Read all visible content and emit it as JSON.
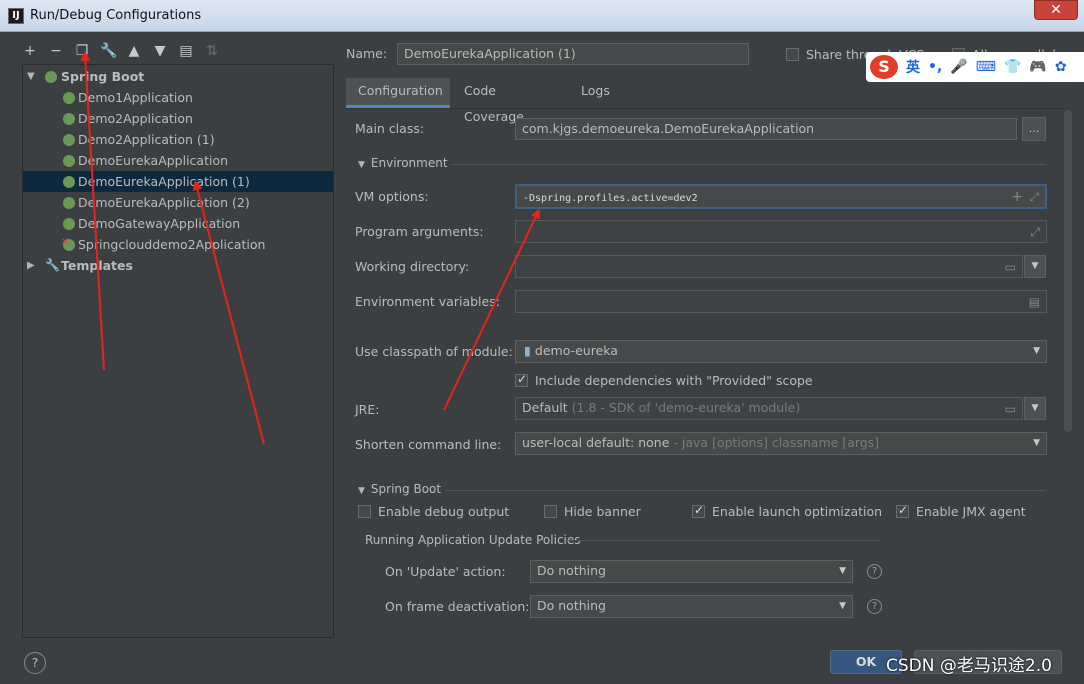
{
  "window": {
    "title": "Run/Debug Configurations",
    "app_icon_letter": "IJ",
    "close_glyph": "✕"
  },
  "toolbar": [
    {
      "name": "add-icon",
      "glyph": "+"
    },
    {
      "name": "remove-icon",
      "glyph": "−"
    },
    {
      "name": "copy-icon",
      "glyph": "❐"
    },
    {
      "name": "wrench-icon",
      "glyph": "🔧"
    },
    {
      "name": "move-up-icon",
      "glyph": "▲"
    },
    {
      "name": "move-down-icon",
      "glyph": "▼"
    },
    {
      "name": "folder-icon",
      "glyph": "▤"
    },
    {
      "name": "sort-icon",
      "glyph": "⇅"
    }
  ],
  "tree": {
    "spring_boot": "Spring Boot",
    "items": [
      "Demo1Application",
      "Demo2Application",
      "Demo2Application (1)",
      "DemoEurekaApplication",
      "DemoEurekaApplication (1)",
      "DemoEurekaApplication (2)",
      "DemoGatewayApplication",
      "Springclouddemo2Application"
    ],
    "templates": "Templates"
  },
  "header": {
    "name_label": "Name:",
    "name_value": "DemoEurekaApplication (1)",
    "share_label": "Share through VCS",
    "parallel_label": "Allow parallel run"
  },
  "tabs": [
    "Configuration",
    "Code Coverage",
    "Logs"
  ],
  "config": {
    "main_class_label": "Main class:",
    "main_class_value": "com.kjgs.demoeureka.DemoEurekaApplication",
    "main_class_btn": "...",
    "environment_label": "Environment",
    "vm_options_label": "VM options:",
    "vm_options_value": "-Dspring.profiles.active=dev2",
    "program_args_label": "Program arguments:",
    "working_dir_label": "Working directory:",
    "env_vars_label": "Environment variables:",
    "classpath_label": "Use classpath of module:",
    "classpath_value": "demo-eureka",
    "include_deps_label": "Include dependencies with \"Provided\" scope",
    "jre_label": "JRE:",
    "jre_value": "Default",
    "jre_hint": "(1.8 - SDK of 'demo-eureka' module)",
    "shorten_label": "Shorten command line:",
    "shorten_value": "user-local default: none",
    "shorten_hint": "- java [options] classname [args]"
  },
  "spring_boot": {
    "section_label": "Spring Boot",
    "debug_output": "Enable debug output",
    "hide_banner": "Hide banner",
    "launch_opt": "Enable launch optimization",
    "jmx_agent": "Enable JMX agent",
    "policies_label": "Running Application Update Policies",
    "on_update_label": "On 'Update' action:",
    "on_update_value": "Do nothing",
    "on_frame_label": "On frame deactivation:",
    "on_frame_value": "Do nothing"
  },
  "footer": {
    "ok_label": "OK",
    "help_glyph": "?",
    "watermark": "CSDN @老马识途2.0"
  },
  "ime": {
    "logo": "S",
    "items": [
      "英",
      "•,",
      "🎤",
      "⌨",
      "👕",
      "🎮",
      "✿"
    ]
  },
  "colors": {
    "selection": "#0d293e",
    "accent": "#4a88c7",
    "annotation_arrow": "#e8231b"
  }
}
